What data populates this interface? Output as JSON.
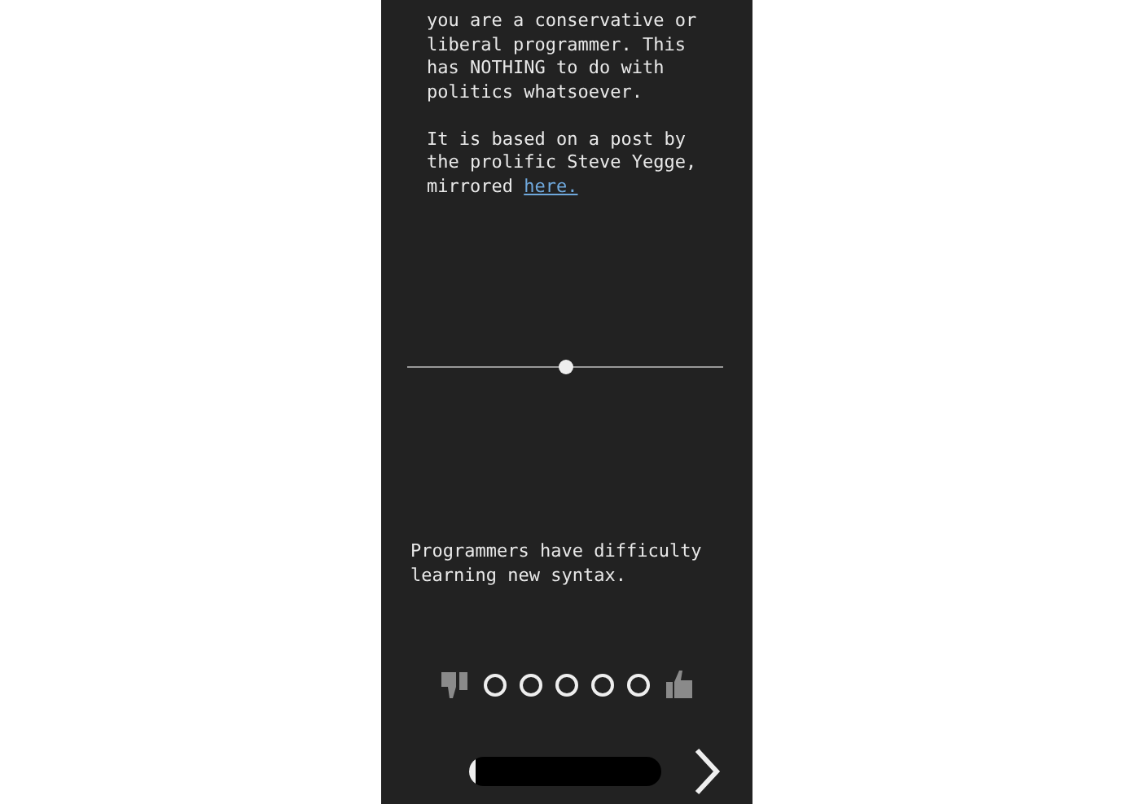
{
  "intro": {
    "paragraphs": [
      "you are a conservative or liberal programmer. This has NOTHING to do with politics whatsoever."
    ],
    "source_text": "It is based on a post by the prolific Steve Yegge, mirrored ",
    "link": "here."
  },
  "slider": {
    "level": 0.5
  },
  "question": "Programmers have difficulty learning new syntax.",
  "rating": [
    {
      "selected": false
    },
    {
      "selected": false
    },
    {
      "selected": false
    },
    {
      "selected": false
    },
    {
      "selected": false
    }
  ],
  "progress": {
    "level": 0.03
  }
}
